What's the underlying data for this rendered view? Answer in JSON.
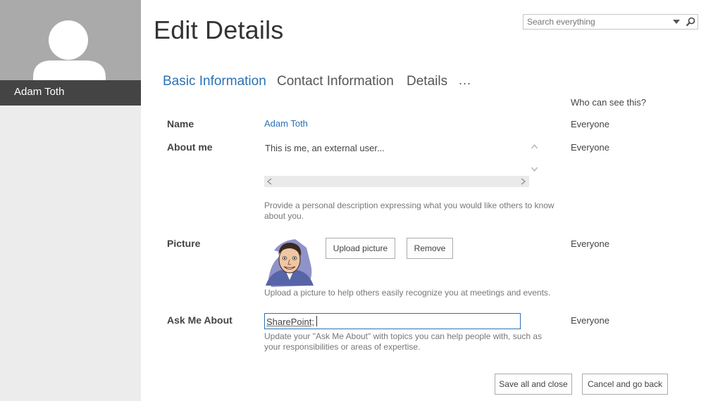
{
  "profile": {
    "name": "Adam Toth"
  },
  "page": {
    "title": "Edit Details"
  },
  "search": {
    "placeholder": "Search everything"
  },
  "tabs": [
    {
      "label": "Basic Information",
      "active": true
    },
    {
      "label": "Contact Information",
      "active": false
    },
    {
      "label": "Details",
      "active": false
    }
  ],
  "more_label": "...",
  "who_can_see": "Who can see this?",
  "fields": {
    "name": {
      "label": "Name",
      "value": "Adam Toth",
      "visibility": "Everyone"
    },
    "about": {
      "label": "About me",
      "value": "This is me, an external user...",
      "help": "Provide a personal description expressing what you would like others to know about you.",
      "visibility": "Everyone"
    },
    "picture": {
      "label": "Picture",
      "upload_label": "Upload picture",
      "remove_label": "Remove",
      "help": "Upload a picture to help others easily recognize you at meetings and events.",
      "visibility": "Everyone"
    },
    "ask": {
      "label": "Ask Me About",
      "value": "SharePoint;",
      "help": "Update your \"Ask Me About\" with topics you can help people with, such as your responsibilities or areas of expertise.",
      "visibility": "Everyone"
    }
  },
  "actions": {
    "save_label": "Save all and close",
    "cancel_label": "Cancel and go back"
  },
  "colors": {
    "accent": "#2a72b5",
    "rail": "#ececec",
    "profile_bg": "#aaaaaa",
    "name_bar": "#444444"
  }
}
